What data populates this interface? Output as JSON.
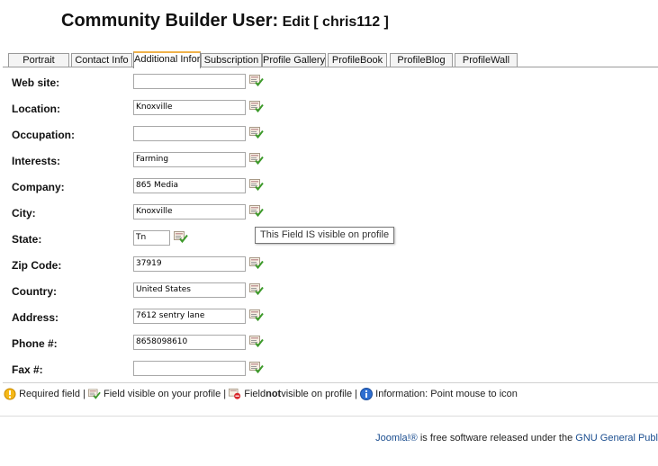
{
  "header": {
    "title": "Community Builder User:",
    "action": "Edit",
    "username_display": "[ chris112 ]"
  },
  "tabs": [
    {
      "label": "Portrait"
    },
    {
      "label": "Contact Info"
    },
    {
      "label": "Additional Infor",
      "active": true
    },
    {
      "label": "Subscription"
    },
    {
      "label": "Profile Gallery"
    },
    {
      "label": "ProfileBook"
    },
    {
      "label": "ProfileBlog"
    },
    {
      "label": "ProfileWall"
    }
  ],
  "fields": [
    {
      "label": "Web site:",
      "value": ""
    },
    {
      "label": "Location:",
      "value": "Knoxville"
    },
    {
      "label": "Occupation:",
      "value": ""
    },
    {
      "label": "Interests:",
      "value": "Farming"
    },
    {
      "label": "Company:",
      "value": "865 Media"
    },
    {
      "label": "City:",
      "value": "Knoxville"
    },
    {
      "label": "State:",
      "value": "Tn"
    },
    {
      "label": "Zip Code:",
      "value": "37919"
    },
    {
      "label": "Country:",
      "value": "United States"
    },
    {
      "label": "Address:",
      "value": "7612 sentry lane"
    },
    {
      "label": "Phone #:",
      "value": "8658098610"
    },
    {
      "label": "Fax #:",
      "value": ""
    }
  ],
  "tooltip": "This Field IS visible on profile",
  "legend": {
    "required": "Required field",
    "sep": "|",
    "visible": "Field visible on your profile",
    "not_visible_a": "Field",
    "not_visible_b": "not",
    "not_visible_c": "visible on profile",
    "info": "Information: Point mouse to icon"
  },
  "footer": {
    "joomla": "Joomla!®",
    "text": "is free software released under the",
    "license": "GNU General Publ"
  },
  "icons": {
    "visible": "field-visible-icon",
    "not_visible": "field-not-visible-icon",
    "required": "required-icon",
    "info": "info-icon"
  },
  "colors": {
    "tab_active_accent": "#f0b24a",
    "link": "#1a4d8f"
  }
}
